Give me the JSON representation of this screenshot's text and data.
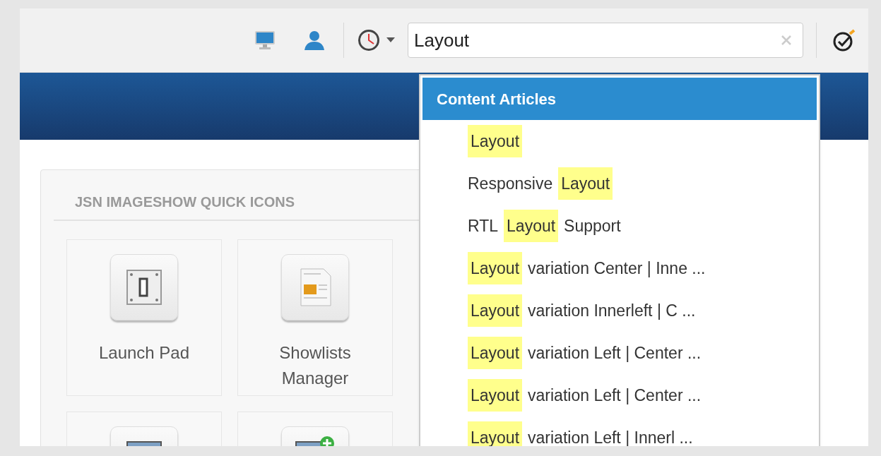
{
  "toolbar": {
    "search": {
      "value": "Layout"
    }
  },
  "panel": {
    "title": "JSN IMAGESHOW QUICK ICONS",
    "tiles": [
      {
        "label": "Launch Pad",
        "kind": "switch"
      },
      {
        "label": "Showlists Manager",
        "kind": "document"
      },
      {
        "kind": "screen"
      },
      {
        "kind": "screen-add"
      }
    ]
  },
  "results": {
    "group": "Content Articles",
    "items": [
      {
        "parts": [
          {
            "text": "Layout",
            "highlighted": true
          }
        ]
      },
      {
        "parts": [
          {
            "text": "Responsive",
            "highlighted": false
          },
          {
            "text": "Layout",
            "highlighted": true
          }
        ]
      },
      {
        "parts": [
          {
            "text": "RTL",
            "highlighted": false
          },
          {
            "text": "Layout",
            "highlighted": true
          },
          {
            "text": "Support",
            "highlighted": false
          }
        ]
      },
      {
        "parts": [
          {
            "text": "Layout",
            "highlighted": true
          },
          {
            "text": "variation Center | Inne ...",
            "highlighted": false
          }
        ]
      },
      {
        "parts": [
          {
            "text": "Layout",
            "highlighted": true
          },
          {
            "text": "variation Innerleft | C ...",
            "highlighted": false
          }
        ]
      },
      {
        "parts": [
          {
            "text": "Layout",
            "highlighted": true
          },
          {
            "text": "variation Left | Center ...",
            "highlighted": false
          }
        ]
      },
      {
        "parts": [
          {
            "text": "Layout",
            "highlighted": true
          },
          {
            "text": "variation Left | Center ...",
            "highlighted": false
          }
        ]
      },
      {
        "parts": [
          {
            "text": "Layout",
            "highlighted": true
          },
          {
            "text": "variation Left | Innerl ...",
            "highlighted": false
          }
        ]
      }
    ]
  }
}
